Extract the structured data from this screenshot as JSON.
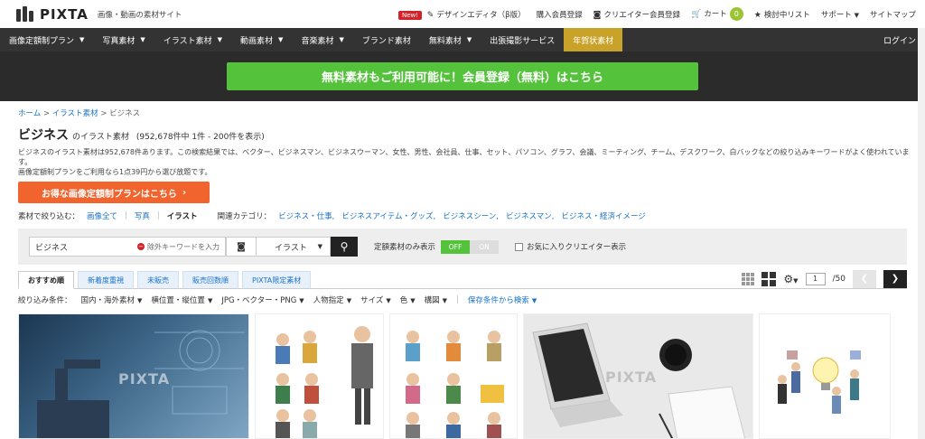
{
  "header": {
    "brand": "PIXTA",
    "tagline": "画像・動画の素材サイト",
    "new_badge": "New!",
    "links": {
      "design_editor": "デザインエディタ（β版）",
      "register": "購入会員登録",
      "creator_register": "クリエイター会員登録",
      "cart": "カート",
      "cart_count": "0",
      "watchlist": "検討中リスト",
      "support": "サポート",
      "sitemap": "サイトマップ"
    }
  },
  "nav": {
    "items": [
      {
        "label": "画像定額制プラン",
        "caret": true
      },
      {
        "label": "写真素材",
        "caret": true
      },
      {
        "label": "イラスト素材",
        "caret": true
      },
      {
        "label": "動画素材",
        "caret": true
      },
      {
        "label": "音楽素材",
        "caret": true
      },
      {
        "label": "ブランド素材",
        "caret": false
      },
      {
        "label": "無料素材",
        "caret": true
      },
      {
        "label": "出張撮影サービス",
        "caret": false
      },
      {
        "label": "年賀状素材",
        "caret": false
      }
    ],
    "login": "ログイン"
  },
  "banner": {
    "label": "無料素材もご利用可能に！会員登録（無料）はこちら"
  },
  "breadcrumb": {
    "home": "ホーム",
    "sep": ">",
    "illust": "イラスト素材",
    "current": "ビジネス"
  },
  "page": {
    "title": "ビジネス",
    "title_suffix": "のイラスト素材",
    "count": "(952,678件中 1件 - 200件を表示)",
    "desc1": "ビジネスのイラスト素材は952,678件あります。この検索結果では、ベクター、ビジネスマン、ビジネスウーマン、女性、男性、会社員、仕事、セット、パソコン、グラフ、会議、ミーティング、チーム、デスクワーク、白バックなどの絞り込みキーワードがよく使われています。",
    "desc2": "画像定額制プランをご利用なら1点39円から選び放題です。",
    "plan_button": "お得な画像定額制プランはこちら"
  },
  "filters": {
    "prefix": "素材で絞り込む：",
    "all": "画像全て",
    "photo": "写真",
    "illust": "イラスト",
    "related_prefix": "関連カテゴリ：",
    "related": [
      "ビジネス・仕事,",
      "ビジネスアイテム・グッズ,",
      "ビジネスシーン,",
      "ビジネスマン,",
      "ビジネス・経済イメージ"
    ]
  },
  "search": {
    "keyword": "ビジネス",
    "exclude_placeholder": "除外キーワードを入力",
    "type": "イラスト",
    "fixed_label": "定額素材のみ表示",
    "toggle_on": "OFF",
    "toggle_off": "ON",
    "fav_creator": "お気に入りクリエイター表示"
  },
  "tabs": [
    {
      "label": "おすすめ順",
      "active": true
    },
    {
      "label": "新着度重視",
      "active": false
    },
    {
      "label": "未販売",
      "active": false
    },
    {
      "label": "販売回数順",
      "active": false
    },
    {
      "label": "PIXTA限定素材",
      "active": false
    }
  ],
  "pagination": {
    "current": "1",
    "total": "/50"
  },
  "conditions": {
    "prefix": "絞り込み条件：",
    "items": [
      "国内・海外素材",
      "横位置・縦位置",
      "JPG・ベクター・PNG",
      "人物指定",
      "サイズ",
      "色",
      "構図"
    ],
    "saved": "保存条件から検索"
  },
  "watermark": "PIXTA",
  "colors": {
    "nav_bg": "#333333",
    "banner_bg": "#2b2b2b",
    "banner_btn": "#55c23b",
    "plan_btn": "#f2642d",
    "highlight_nav": "#c9a22a",
    "link": "#1a73c8"
  }
}
